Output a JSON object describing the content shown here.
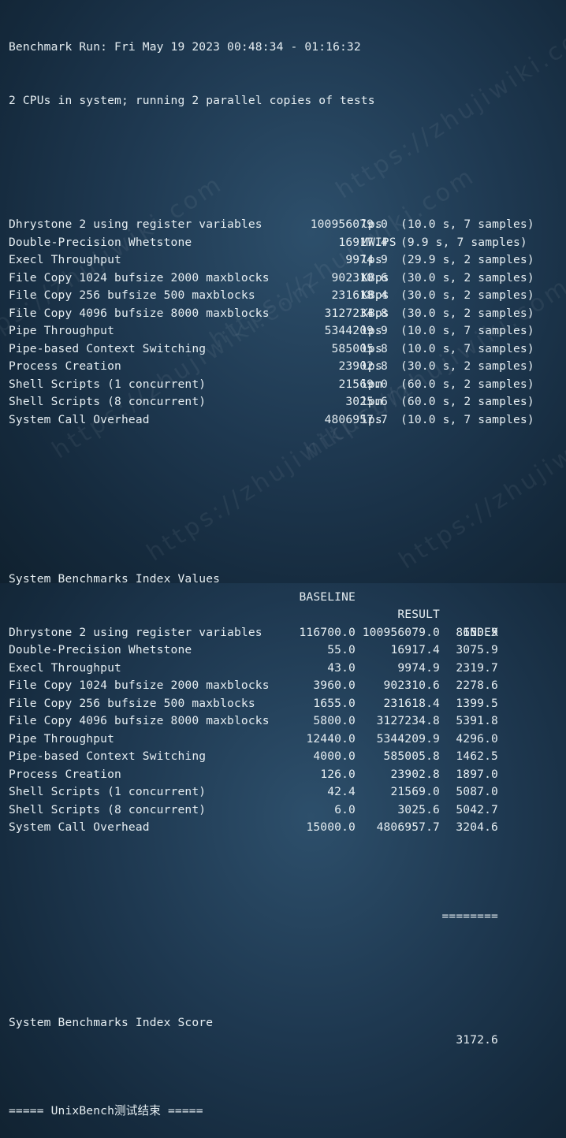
{
  "header": {
    "run_line": "Benchmark Run: Fri May 19 2023 00:48:34 - 01:16:32",
    "cpu_line": "2 CPUs in system; running 2 parallel copies of tests"
  },
  "results": [
    {
      "name": "Dhrystone 2 using register variables",
      "value": "100956079.0",
      "unit": "lps",
      "timing": "(10.0 s, 7 samples)"
    },
    {
      "name": "Double-Precision Whetstone",
      "value": "16917.4",
      "unit": "MWIPS",
      "timing": "(9.9 s, 7 samples)"
    },
    {
      "name": "Execl Throughput",
      "value": "9974.9",
      "unit": "lps",
      "timing": "(29.9 s, 2 samples)"
    },
    {
      "name": "File Copy 1024 bufsize 2000 maxblocks",
      "value": "902310.6",
      "unit": "KBps",
      "timing": "(30.0 s, 2 samples)"
    },
    {
      "name": "File Copy 256 bufsize 500 maxblocks",
      "value": "231618.4",
      "unit": "KBps",
      "timing": "(30.0 s, 2 samples)"
    },
    {
      "name": "File Copy 4096 bufsize 8000 maxblocks",
      "value": "3127234.8",
      "unit": "KBps",
      "timing": "(30.0 s, 2 samples)"
    },
    {
      "name": "Pipe Throughput",
      "value": "5344209.9",
      "unit": "lps",
      "timing": "(10.0 s, 7 samples)"
    },
    {
      "name": "Pipe-based Context Switching",
      "value": "585005.8",
      "unit": "lps",
      "timing": "(10.0 s, 7 samples)"
    },
    {
      "name": "Process Creation",
      "value": "23902.8",
      "unit": "lps",
      "timing": "(30.0 s, 2 samples)"
    },
    {
      "name": "Shell Scripts (1 concurrent)",
      "value": "21569.0",
      "unit": "lpm",
      "timing": "(60.0 s, 2 samples)"
    },
    {
      "name": "Shell Scripts (8 concurrent)",
      "value": "3025.6",
      "unit": "lpm",
      "timing": "(60.0 s, 2 samples)"
    },
    {
      "name": "System Call Overhead",
      "value": "4806957.7",
      "unit": "lps",
      "timing": "(10.0 s, 7 samples)"
    }
  ],
  "index_table": {
    "title": "System Benchmarks Index Values",
    "col_baseline": "BASELINE",
    "col_result": "RESULT",
    "col_index": "INDEX",
    "rows": [
      {
        "name": "Dhrystone 2 using register variables",
        "baseline": "116700.0",
        "result": "100956079.0",
        "index": "8650.9"
      },
      {
        "name": "Double-Precision Whetstone",
        "baseline": "55.0",
        "result": "16917.4",
        "index": "3075.9"
      },
      {
        "name": "Execl Throughput",
        "baseline": "43.0",
        "result": "9974.9",
        "index": "2319.7"
      },
      {
        "name": "File Copy 1024 bufsize 2000 maxblocks",
        "baseline": "3960.0",
        "result": "902310.6",
        "index": "2278.6"
      },
      {
        "name": "File Copy 256 bufsize 500 maxblocks",
        "baseline": "1655.0",
        "result": "231618.4",
        "index": "1399.5"
      },
      {
        "name": "File Copy 4096 bufsize 8000 maxblocks",
        "baseline": "5800.0",
        "result": "3127234.8",
        "index": "5391.8"
      },
      {
        "name": "Pipe Throughput",
        "baseline": "12440.0",
        "result": "5344209.9",
        "index": "4296.0"
      },
      {
        "name": "Pipe-based Context Switching",
        "baseline": "4000.0",
        "result": "585005.8",
        "index": "1462.5"
      },
      {
        "name": "Process Creation",
        "baseline": "126.0",
        "result": "23902.8",
        "index": "1897.0"
      },
      {
        "name": "Shell Scripts (1 concurrent)",
        "baseline": "42.4",
        "result": "21569.0",
        "index": "5087.0"
      },
      {
        "name": "Shell Scripts (8 concurrent)",
        "baseline": "6.0",
        "result": "3025.6",
        "index": "5042.7"
      },
      {
        "name": "System Call Overhead",
        "baseline": "15000.0",
        "result": "4806957.7",
        "index": "3204.6"
      }
    ],
    "separator": "========",
    "score_label": "System Benchmarks Index Score",
    "score_value": "3172.6"
  },
  "footer": "===== UnixBench测试结束 =====",
  "watermark_text": "https://zhujiwiki.com",
  "colors": {
    "background": "#1e3850",
    "text": "#e6eef2"
  }
}
